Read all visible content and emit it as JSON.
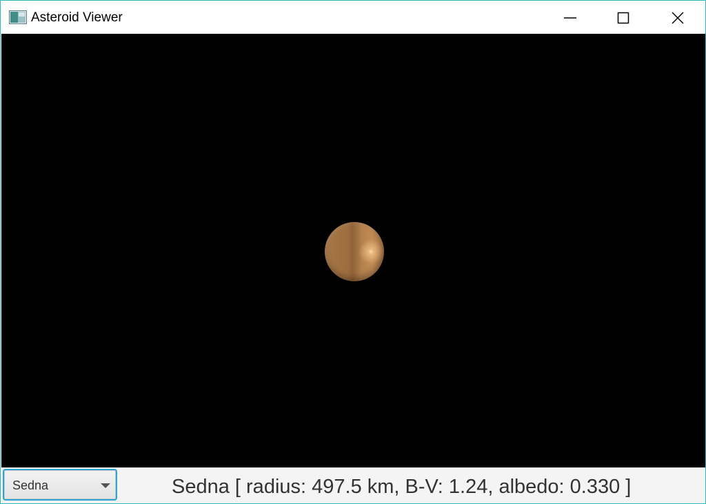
{
  "window": {
    "title": "Asteroid Viewer"
  },
  "titlebar_buttons": {
    "minimize_icon": "minimize-icon",
    "maximize_icon": "maximize-icon",
    "close_icon": "close-icon"
  },
  "viewport": {
    "background": "#000000",
    "object": "sphere",
    "object_color": "#b07a48"
  },
  "selector": {
    "selected": "Sedna"
  },
  "status": {
    "text": "Sedna [ radius: 497.5 km, B-V: 1.24, albedo: 0.330 ]"
  },
  "colors": {
    "accent_border": "#2bb9c4",
    "focus_ring": "#2aa6d6"
  }
}
